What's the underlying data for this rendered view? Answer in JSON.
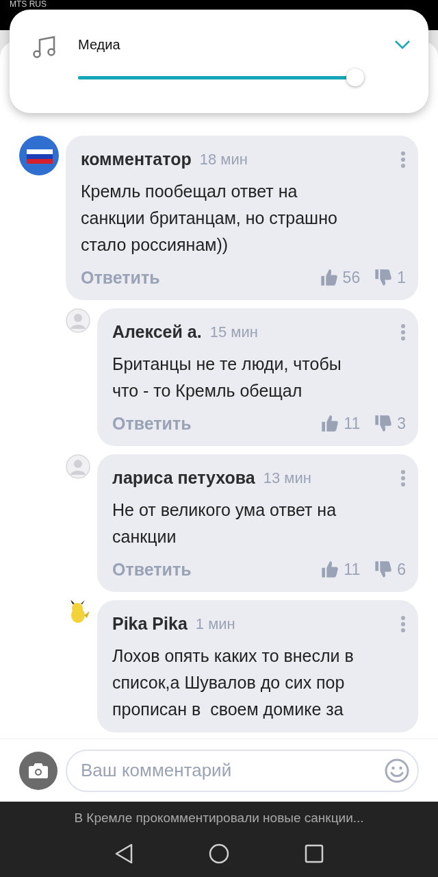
{
  "status_bar": {
    "carrier": "MTS RUS"
  },
  "volume_panel": {
    "label": "Медиа",
    "level": 0.97,
    "expanded": false
  },
  "comments": [
    {
      "author": "комментатор",
      "time": "18 мин",
      "avatar": {
        "kind": "flag"
      },
      "text": [
        "Кремль пообещал ответ на",
        "санкции британцам, но страшно",
        "стало россиянам))"
      ],
      "reply": "Ответить",
      "likes": "56",
      "dislikes": "1",
      "replies": [
        {
          "author": "Алексей а.",
          "time": "15 мин",
          "avatar": {
            "kind": "default"
          },
          "text": [
            "Британцы не те люди, чтобы",
            "что - то Кремль обещал"
          ],
          "reply": "Ответить",
          "likes": "11",
          "dislikes": "3"
        },
        {
          "author": "лариса петухова",
          "time": "13 мин",
          "avatar": {
            "kind": "default"
          },
          "text": [
            "Не от великого ума ответ на",
            "санкции"
          ],
          "reply": "Ответить",
          "likes": "11",
          "dislikes": "6"
        },
        {
          "author": "Pika Pika",
          "time": "1 мин",
          "text": [
            "Лохов опять каких то внесли в",
            "список,а Шувалов до сих пор",
            "прописан в  своем домике за"
          ]
        }
      ]
    }
  ],
  "comment_input": {
    "placeholder": "Ваш комментарий"
  },
  "caption": "В Кремле прокомментировали новые санкции..."
}
